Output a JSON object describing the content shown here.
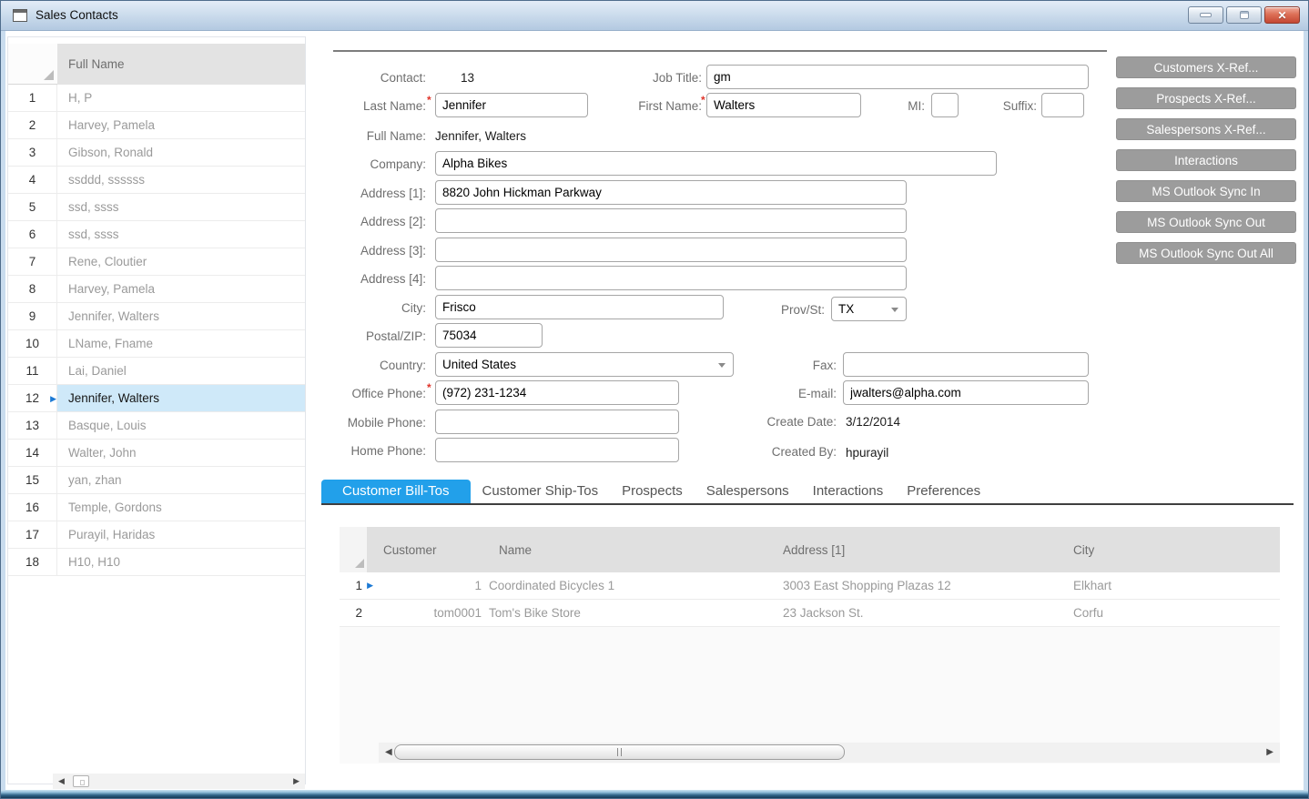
{
  "window": {
    "title": "Sales Contacts",
    "controls": {
      "minimize": "minimize",
      "restore": "restore",
      "close": "close"
    }
  },
  "contact_list": {
    "header": "Full Name",
    "selected_row": 12,
    "rows": [
      {
        "num": 1,
        "name": "H, P"
      },
      {
        "num": 2,
        "name": "Harvey, Pamela"
      },
      {
        "num": 3,
        "name": "Gibson, Ronald"
      },
      {
        "num": 4,
        "name": "ssddd, ssssss"
      },
      {
        "num": 5,
        "name": "ssd, ssss"
      },
      {
        "num": 6,
        "name": "ssd, ssss"
      },
      {
        "num": 7,
        "name": "Rene, Cloutier"
      },
      {
        "num": 8,
        "name": "Harvey, Pamela"
      },
      {
        "num": 9,
        "name": "Jennifer, Walters"
      },
      {
        "num": 10,
        "name": "LName, Fname"
      },
      {
        "num": 11,
        "name": "Lai, Daniel"
      },
      {
        "num": 12,
        "name": "Jennifer, Walters"
      },
      {
        "num": 13,
        "name": "Basque, Louis"
      },
      {
        "num": 14,
        "name": "Walter, John"
      },
      {
        "num": 15,
        "name": "yan, zhan"
      },
      {
        "num": 16,
        "name": "Temple, Gordons"
      },
      {
        "num": 17,
        "name": "Purayil, Haridas"
      },
      {
        "num": 18,
        "name": "H10, H10"
      }
    ]
  },
  "form": {
    "contact": {
      "label": "Contact:",
      "value": "13"
    },
    "job_title": {
      "label": "Job Title:",
      "value": "gm"
    },
    "last_name": {
      "label": "Last Name:",
      "value": "Jennifer"
    },
    "first_name": {
      "label": "First Name:",
      "value": "Walters"
    },
    "mi": {
      "label": "MI:",
      "value": ""
    },
    "suffix": {
      "label": "Suffix:",
      "value": ""
    },
    "full_name": {
      "label": "Full Name:",
      "value": "Jennifer, Walters"
    },
    "company": {
      "label": "Company:",
      "value": "Alpha Bikes"
    },
    "address1": {
      "label": "Address [1]:",
      "value": "8820 John Hickman Parkway"
    },
    "address2": {
      "label": "Address [2]:",
      "value": ""
    },
    "address3": {
      "label": "Address [3]:",
      "value": ""
    },
    "address4": {
      "label": "Address [4]:",
      "value": ""
    },
    "city": {
      "label": "City:",
      "value": "Frisco"
    },
    "prov_st": {
      "label": "Prov/St:",
      "value": "TX"
    },
    "postal_zip": {
      "label": "Postal/ZIP:",
      "value": "75034"
    },
    "country": {
      "label": "Country:",
      "value": "United States"
    },
    "office_phone": {
      "label": "Office Phone:",
      "value": "(972) 231-1234"
    },
    "mobile_phone": {
      "label": "Mobile Phone:",
      "value": ""
    },
    "home_phone": {
      "label": "Home Phone:",
      "value": ""
    },
    "fax": {
      "label": "Fax:",
      "value": ""
    },
    "email": {
      "label": "E-mail:",
      "value": "jwalters@alpha.com"
    },
    "create_date": {
      "label": "Create Date:",
      "value": "3/12/2014"
    },
    "created_by": {
      "label": "Created By:",
      "value": "hpurayil"
    }
  },
  "action_buttons": [
    "Customers X-Ref...",
    "Prospects X-Ref...",
    "Salespersons X-Ref...",
    "Interactions",
    "MS Outlook Sync In",
    "MS Outlook Sync Out",
    "MS Outlook Sync Out All"
  ],
  "tabs": {
    "active": "Customer Bill-Tos",
    "items": [
      "Customer Bill-Tos",
      "Customer Ship-Tos",
      "Prospects",
      "Salespersons",
      "Interactions",
      "Preferences"
    ]
  },
  "billtos_grid": {
    "columns": [
      "Customer",
      "Name",
      "Address [1]",
      "City"
    ],
    "rows": [
      {
        "num": 1,
        "customer": "1",
        "name": "Coordinated Bicycles 1",
        "address1": "3003 East Shopping Plazas 12",
        "city": "Elkhart",
        "selected": true
      },
      {
        "num": 2,
        "customer": "tom0001",
        "name": "Tom's Bike Store",
        "address1": "23 Jackson St.",
        "city": "Corfu",
        "selected": false
      }
    ]
  },
  "colors": {
    "accent_blue": "#22a0ea",
    "selected_row_bg": "#cfe9f9",
    "button_gray": "#9c9c9c",
    "required_red": "#e0352b"
  }
}
